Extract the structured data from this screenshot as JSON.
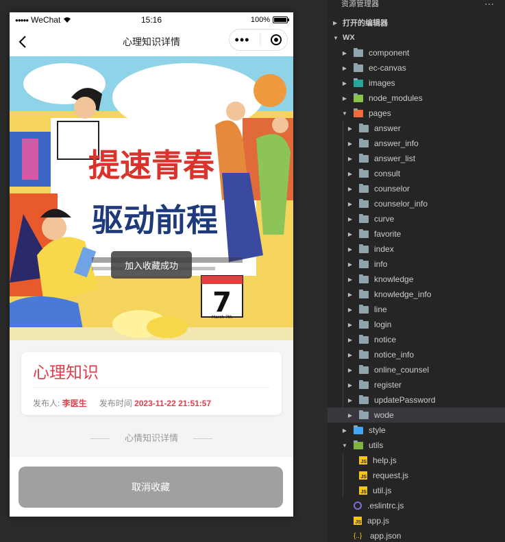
{
  "status_bar": {
    "signal": "●●●●●",
    "carrier": "WeChat",
    "time": "15:16",
    "battery": "100%"
  },
  "nav": {
    "title": "心理知识详情"
  },
  "toast": "加入收藏成功",
  "info": {
    "title": "心理知识",
    "publisher_label": "发布人:",
    "publisher": "李医生",
    "time_label": "发布时间",
    "time": "2023-11-22 21:51:57"
  },
  "section_label": "心情知识详情",
  "button": {
    "cancel_favorite": "取消收藏"
  },
  "banner": {
    "title_line1": "提速青春",
    "title_line2": "驱动前程",
    "calendar_day": "7",
    "calendar_month": "March 7th"
  },
  "explorer": {
    "header": "资源管理器",
    "more": "···",
    "open_editors": "打开的编辑器",
    "root": "WX",
    "items": [
      {
        "label": "component",
        "type": "folder",
        "depth": 1,
        "expanded": false
      },
      {
        "label": "ec-canvas",
        "type": "folder",
        "depth": 1,
        "expanded": false
      },
      {
        "label": "images",
        "type": "folder-images",
        "depth": 1,
        "expanded": false
      },
      {
        "label": "node_modules",
        "type": "folder-node",
        "depth": 1,
        "expanded": false
      },
      {
        "label": "pages",
        "type": "folder-pages",
        "depth": 1,
        "expanded": true
      },
      {
        "label": "answer",
        "type": "folder",
        "depth": 2,
        "expanded": false
      },
      {
        "label": "answer_info",
        "type": "folder",
        "depth": 2,
        "expanded": false
      },
      {
        "label": "answer_list",
        "type": "folder",
        "depth": 2,
        "expanded": false
      },
      {
        "label": "consult",
        "type": "folder",
        "depth": 2,
        "expanded": false
      },
      {
        "label": "counselor",
        "type": "folder",
        "depth": 2,
        "expanded": false
      },
      {
        "label": "counselor_info",
        "type": "folder",
        "depth": 2,
        "expanded": false
      },
      {
        "label": "curve",
        "type": "folder",
        "depth": 2,
        "expanded": false
      },
      {
        "label": "favorite",
        "type": "folder",
        "depth": 2,
        "expanded": false
      },
      {
        "label": "index",
        "type": "folder",
        "depth": 2,
        "expanded": false
      },
      {
        "label": "info",
        "type": "folder",
        "depth": 2,
        "expanded": false
      },
      {
        "label": "knowledge",
        "type": "folder",
        "depth": 2,
        "expanded": false
      },
      {
        "label": "knowledge_info",
        "type": "folder",
        "depth": 2,
        "expanded": false
      },
      {
        "label": "line",
        "type": "folder",
        "depth": 2,
        "expanded": false
      },
      {
        "label": "login",
        "type": "folder",
        "depth": 2,
        "expanded": false
      },
      {
        "label": "notice",
        "type": "folder",
        "depth": 2,
        "expanded": false
      },
      {
        "label": "notice_info",
        "type": "folder",
        "depth": 2,
        "expanded": false
      },
      {
        "label": "online_counsel",
        "type": "folder",
        "depth": 2,
        "expanded": false
      },
      {
        "label": "register",
        "type": "folder",
        "depth": 2,
        "expanded": false
      },
      {
        "label": "updatePassword",
        "type": "folder",
        "depth": 2,
        "expanded": false
      },
      {
        "label": "wode",
        "type": "folder",
        "depth": 2,
        "expanded": false,
        "selected": true
      },
      {
        "label": "style",
        "type": "folder-style",
        "depth": 1,
        "expanded": false
      },
      {
        "label": "utils",
        "type": "folder-utils",
        "depth": 1,
        "expanded": true
      },
      {
        "label": "help.js",
        "type": "js",
        "depth": 2
      },
      {
        "label": "request.js",
        "type": "js",
        "depth": 2
      },
      {
        "label": "util.js",
        "type": "js",
        "depth": 2
      },
      {
        "label": ".eslintrc.js",
        "type": "eslint",
        "depth": 1
      },
      {
        "label": "app.js",
        "type": "js",
        "depth": 1
      },
      {
        "label": "app.json",
        "type": "json",
        "depth": 1
      }
    ]
  },
  "colors": {
    "accent_red": "#e0404c",
    "button_gray": "#a0a0a0",
    "explorer_bg": "#252526",
    "selected_row": "#37373d"
  }
}
